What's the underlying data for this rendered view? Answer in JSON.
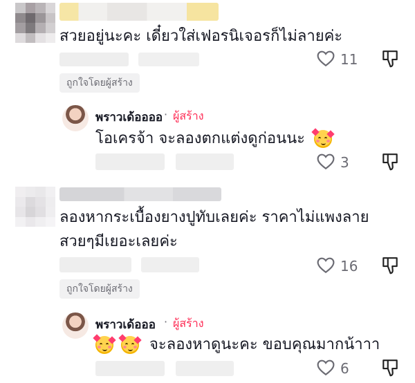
{
  "comments": [
    {
      "text": "สวยอยู่นะคะ เดี๋ยวใส่เฟอรนิเจอรก็ไม่ลายค่ะ",
      "likes": "11",
      "liked_by_creator": "ถูกใจโดยผู้สร้าง",
      "reply": {
        "name": "พราวเด้ออออ",
        "separator": "·",
        "creator_tag": "ผู้สร้าง",
        "text": "โอเครจ้า จะลองตกแต่งดูก่อนนะ",
        "emoji": [
          "smiling-face-with-hearts"
        ],
        "likes": "3"
      }
    },
    {
      "text_line1": "ลองหากระเบื้องยางปูทับเลยค่ะ  ราคาไม่แพงลาย",
      "text_line2": "สวยๆมีเยอะเลยค่ะ",
      "likes": "16",
      "liked_by_creator": "ถูกใจโดยผู้สร้าง",
      "reply": {
        "name": "พราวเด้อออ",
        "separator": "·",
        "creator_tag": "ผู้สร้าง",
        "text": "จะลองหาดูนะคะ ขอบคุณมากน้าาา",
        "emoji": [
          "smiling-face-with-hearts",
          "smiling-face-with-hearts"
        ],
        "likes": "6"
      }
    }
  ],
  "colors": {
    "accent": "#fe2c55",
    "muted": "#6b6b73",
    "badge_bg": "#f1f1f2"
  }
}
